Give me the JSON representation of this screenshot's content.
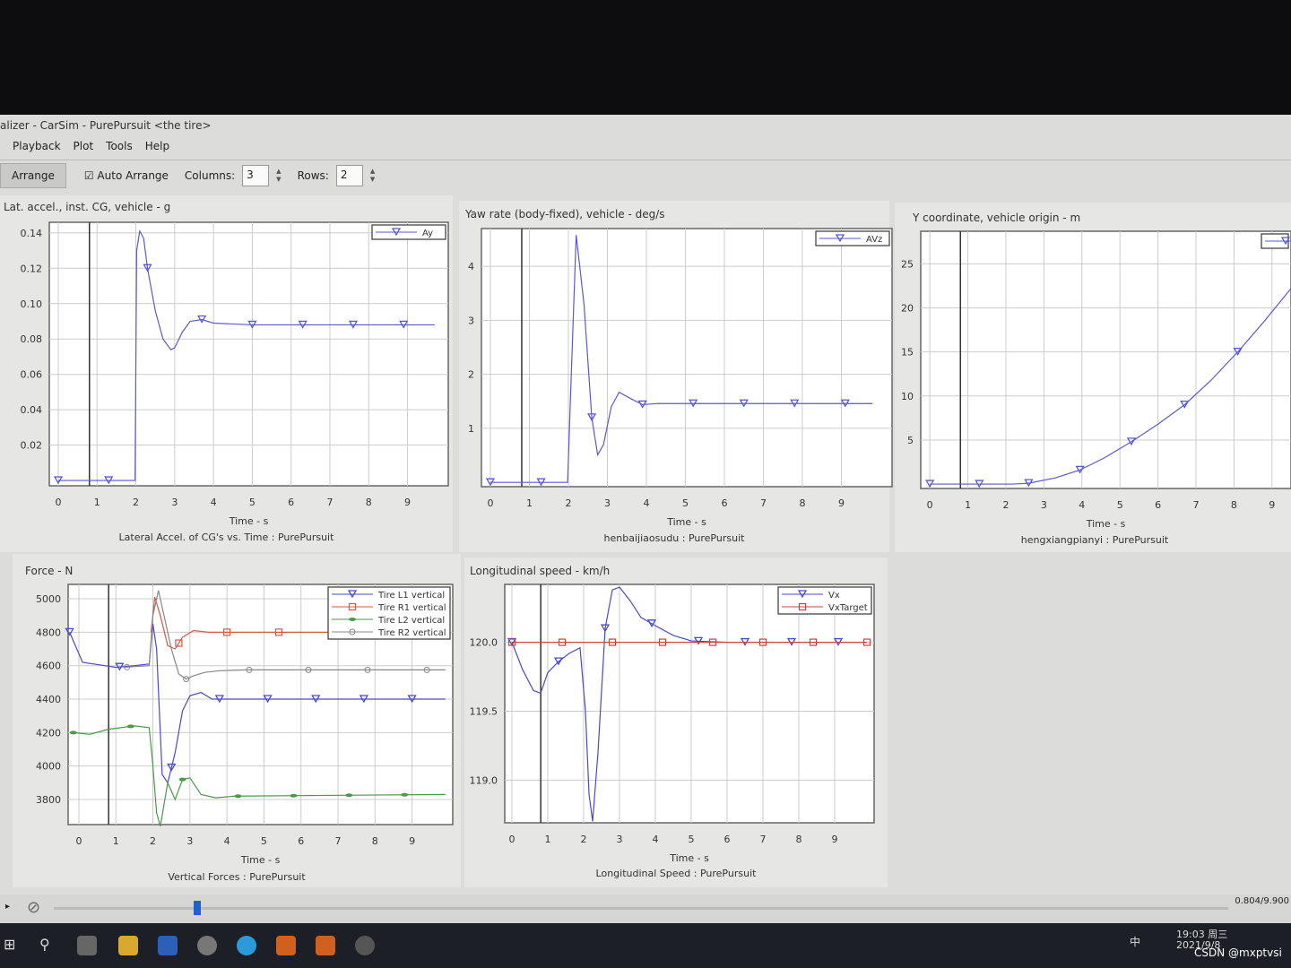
{
  "window": {
    "title": "alizer - CarSim - PurePursuit <the tire>",
    "menu": [
      "Playback",
      "Plot",
      "Tools",
      "Help"
    ],
    "toolbar": {
      "arrange": "Arrange",
      "auto_arrange": "Auto Arrange",
      "auto_arrange_checked": true,
      "columns_label": "Columns:",
      "columns": "3",
      "rows_label": "Rows:",
      "rows": "2"
    },
    "status": {
      "time": "0.804/9.900",
      "progress": 0.081
    }
  },
  "taskbar": {
    "time": "19:03 周三",
    "date": "2021/9/8",
    "ime": "中",
    "watermark": "CSDN @mxptvsi"
  },
  "chart_data": [
    {
      "type": "line",
      "title": "Lat. accel., inst. CG, vehicle - g",
      "xlabel": "Time - s",
      "caption": "Lateral Accel. of CG's vs. Time : PurePursuit",
      "xlim": [
        -0.23,
        10.05
      ],
      "ylim": [
        -0.003,
        0.146
      ],
      "xticks": [
        0,
        1,
        2,
        3,
        4,
        5,
        6,
        7,
        8,
        9
      ],
      "yticks": [
        0.02,
        0.04,
        0.06,
        0.08,
        0.1,
        0.12,
        0.14
      ],
      "ydec": 2,
      "grid": true,
      "legend": "top-right",
      "cursor": 0.804,
      "series": [
        {
          "name": "Ay",
          "color": "#5a5ad0",
          "marker": "triangle",
          "markers": [
            0,
            1.3,
            2.3,
            3.7,
            5,
            6.3,
            7.6,
            8.9
          ],
          "x": [
            0,
            1,
            1.98,
            2.02,
            2.1,
            2.2,
            2.3,
            2.5,
            2.7,
            2.9,
            3.0,
            3.2,
            3.4,
            3.7,
            4,
            5,
            9.7
          ],
          "y": [
            0,
            0,
            0,
            0.13,
            0.141,
            0.137,
            0.12,
            0.096,
            0.08,
            0.074,
            0.075,
            0.084,
            0.09,
            0.091,
            0.089,
            0.088,
            0.088
          ]
        }
      ]
    },
    {
      "type": "line",
      "title": "Yaw rate (body-fixed), vehicle - deg/s",
      "xlabel": "Time - s",
      "caption": "henbaijiaosudu : PurePursuit",
      "xlim": [
        -0.23,
        10.3
      ],
      "ylim": [
        -0.08,
        4.7
      ],
      "xticks": [
        0,
        1,
        2,
        3,
        4,
        5,
        6,
        7,
        8,
        9
      ],
      "yticks": [
        1,
        2,
        3,
        4
      ],
      "ydec": 0,
      "grid": true,
      "legend": "top-right",
      "cursor": 0.804,
      "series": [
        {
          "name": "AVz",
          "color": "#5a5ad0",
          "marker": "triangle",
          "markers": [
            0,
            1.3,
            2.6,
            3.9,
            5.2,
            6.5,
            7.8,
            9.1
          ],
          "x": [
            0,
            1,
            1.98,
            2.05,
            2.2,
            2.4,
            2.6,
            2.75,
            2.9,
            3.1,
            3.3,
            3.6,
            3.9,
            4.3,
            5,
            9.8
          ],
          "y": [
            0,
            0,
            0,
            1.5,
            4.58,
            3.3,
            1.2,
            0.51,
            0.7,
            1.4,
            1.67,
            1.55,
            1.44,
            1.46,
            1.46,
            1.46
          ]
        }
      ]
    },
    {
      "type": "line",
      "title": "Y coordinate, vehicle origin - m",
      "xlabel": "Time - s",
      "caption": "hengxiangpianyi : PurePursuit",
      "xlim": [
        -0.24,
        9.5
      ],
      "ylim": [
        -0.5,
        28.7
      ],
      "xticks": [
        0,
        1,
        2,
        3,
        4,
        5,
        6,
        7,
        8,
        9
      ],
      "yticks": [
        5,
        10,
        15,
        20,
        25
      ],
      "ydec": 0,
      "grid": true,
      "legend": "top-right",
      "cursor": 0.804,
      "series": [
        {
          "name": "",
          "color": "#5a5ad0",
          "marker": "triangle",
          "markers": [
            0,
            1.3,
            2.6,
            3.95,
            5.3,
            6.7,
            8.1
          ],
          "x": [
            0,
            2.2,
            2.6,
            3.3,
            3.95,
            4.6,
            5.3,
            6.0,
            6.7,
            7.4,
            8.1,
            8.8,
            9.5
          ],
          "y": [
            0,
            0,
            0.1,
            0.7,
            1.6,
            3.0,
            4.8,
            6.8,
            9.0,
            11.8,
            15.0,
            18.5,
            22.2
          ]
        }
      ]
    },
    {
      "type": "line",
      "title": "Force - N",
      "xlabel": "Time - s",
      "caption": "Vertical Forces : PurePursuit",
      "xlim": [
        -0.29,
        10.1
      ],
      "ylim": [
        3650,
        5086
      ],
      "xticks": [
        0,
        1,
        2,
        3,
        4,
        5,
        6,
        7,
        8,
        9
      ],
      "yticks": [
        3800,
        4000,
        4200,
        4400,
        4600,
        4800,
        5000
      ],
      "ydec": 0,
      "grid": true,
      "legend": "top-right",
      "cursor": 0.804,
      "series": [
        {
          "name": "Tire L1 vertical",
          "color": "#4a4ac8",
          "marker": "triangle",
          "markers": [
            -0.25,
            1.1,
            2.5,
            3.8,
            5.1,
            6.4,
            7.7,
            9.0
          ],
          "x": [
            -0.25,
            0.1,
            0.4,
            1.0,
            1.5,
            1.9,
            2.0,
            2.1,
            2.25,
            2.4,
            2.6,
            2.8,
            3.0,
            3.3,
            3.6,
            4,
            9.9
          ],
          "y": [
            4800,
            4620,
            4610,
            4590,
            4600,
            4610,
            4850,
            4700,
            3950,
            3900,
            4080,
            4330,
            4420,
            4440,
            4400,
            4400,
            4400
          ]
        },
        {
          "name": "Tire R1 vertical",
          "color": "#d05a4a",
          "marker": "square",
          "markers": [
            2.7,
            4.0,
            5.4
          ],
          "x": [
            1.95,
            2.05,
            2.2,
            2.4,
            2.6,
            2.8,
            3.1,
            3.5,
            4,
            9.9
          ],
          "y": [
            4800,
            5010,
            4900,
            4720,
            4700,
            4770,
            4810,
            4800,
            4800,
            4800
          ]
        },
        {
          "name": "Tire L2 vertical",
          "color": "#4a9a4a",
          "marker": "dot",
          "markers": [
            -0.15,
            1.4,
            2.8,
            4.3,
            5.8,
            7.3,
            8.8
          ],
          "x": [
            -0.15,
            0.3,
            0.8,
            1.5,
            1.9,
            2.0,
            2.1,
            2.2,
            2.4,
            2.6,
            2.8,
            3.0,
            3.3,
            3.7,
            4.2,
            9.9
          ],
          "y": [
            4200,
            4190,
            4220,
            4240,
            4230,
            4000,
            3720,
            3640,
            3900,
            3800,
            3920,
            3930,
            3830,
            3810,
            3820,
            3830
          ]
        },
        {
          "name": "Tire R2 vertical",
          "color": "#888888",
          "marker": "circle",
          "markers": [
            1.3,
            2.9,
            4.6,
            6.2,
            7.8,
            9.4
          ],
          "x": [
            1.2,
            1.9,
            2.0,
            2.15,
            2.3,
            2.5,
            2.7,
            2.9,
            3.1,
            3.4,
            3.8,
            4.5,
            9.9
          ],
          "y": [
            4590,
            4600,
            4900,
            5050,
            4900,
            4700,
            4550,
            4520,
            4540,
            4560,
            4570,
            4575,
            4575
          ]
        }
      ]
    },
    {
      "type": "line",
      "title": "Longitudinal speed - km/h",
      "xlabel": "Time - s",
      "caption": "Longitudinal Speed : PurePursuit",
      "xlim": [
        -0.2,
        10.1
      ],
      "ylim": [
        118.69,
        120.42
      ],
      "xticks": [
        0,
        1,
        2,
        3,
        4,
        5,
        6,
        7,
        8,
        9
      ],
      "yticks": [
        119.0,
        119.5,
        120.0
      ],
      "ydec": 1,
      "grid": true,
      "legend": "top-right",
      "cursor": 0.804,
      "series": [
        {
          "name": "Vx",
          "color": "#4a4ac8",
          "marker": "triangle",
          "markers": [
            0,
            1.3,
            2.6,
            3.9,
            5.2,
            6.5,
            7.8,
            9.1
          ],
          "x": [
            0,
            0.3,
            0.6,
            0.8,
            1.0,
            1.3,
            1.6,
            1.9,
            2.05,
            2.15,
            2.25,
            2.4,
            2.6,
            2.8,
            3.0,
            3.3,
            3.6,
            4,
            4.5,
            5,
            6,
            9.9
          ],
          "y": [
            120,
            119.8,
            119.65,
            119.63,
            119.78,
            119.86,
            119.92,
            119.96,
            119.5,
            118.9,
            118.7,
            119.2,
            120.1,
            120.38,
            120.4,
            120.3,
            120.18,
            120.12,
            120.05,
            120.01,
            120.0,
            120.0
          ]
        },
        {
          "name": "VxTarget",
          "color": "#d04040",
          "marker": "square",
          "markers": [
            0,
            1.4,
            2.8,
            4.2,
            5.6,
            7.0,
            8.4,
            9.9
          ],
          "x": [
            0,
            9.9
          ],
          "y": [
            120,
            120
          ]
        }
      ]
    }
  ]
}
